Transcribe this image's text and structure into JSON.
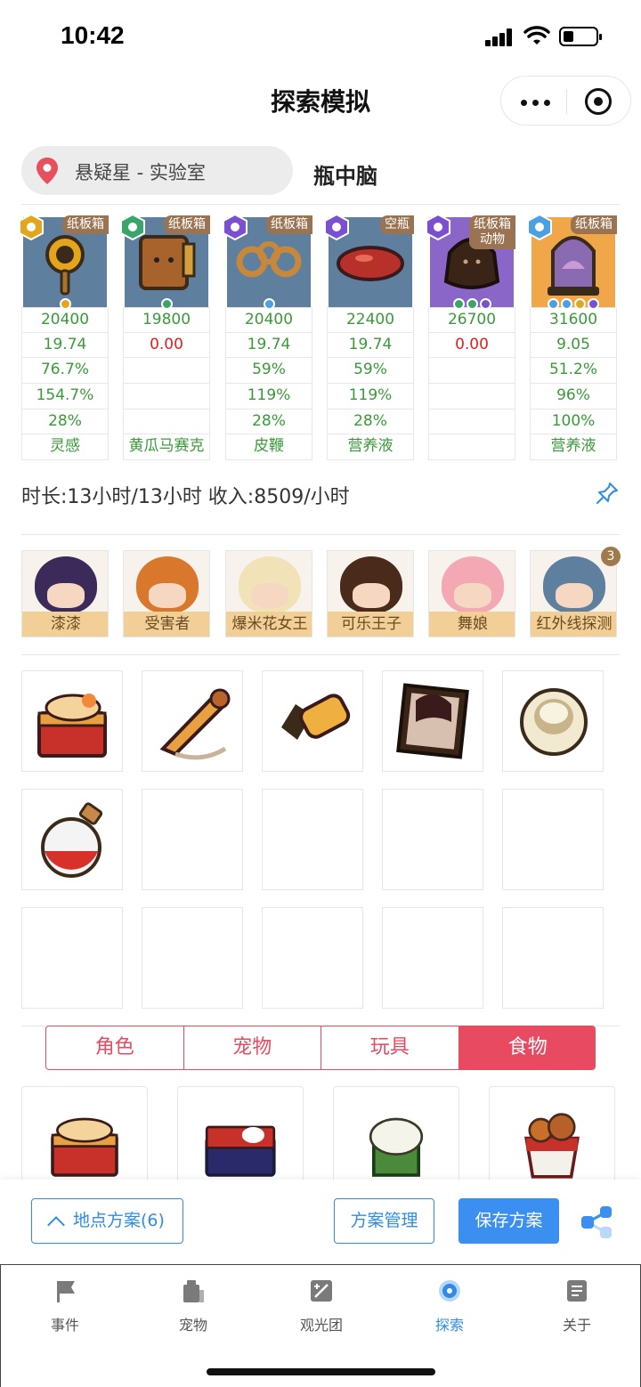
{
  "status": {
    "time": "10:42",
    "battery_level": 0.3
  },
  "nav": {
    "title": "探索模拟"
  },
  "location": {
    "name": "悬疑星 - 实验室",
    "scene": "瓶中脑"
  },
  "results": [
    {
      "tag": "纸板箱",
      "badge_color": "#e2a51c",
      "art": "magnifier",
      "bg": "#5f7f9f",
      "gems": [
        "#e2a51c"
      ],
      "stats": [
        "20400",
        "19.74",
        "76.7%",
        "154.7%",
        "28%",
        "灵感"
      ],
      "red_rows": []
    },
    {
      "tag": "纸板箱",
      "badge_color": "#3aa46a",
      "art": "box",
      "bg": "#5f7f9f",
      "gems": [
        "#3aa46a"
      ],
      "stats": [
        "19800",
        "0.00",
        "",
        "",
        "",
        "黄瓜马赛克"
      ],
      "red_rows": [
        1
      ]
    },
    {
      "tag": "纸板箱",
      "badge_color": "#7a4fd0",
      "art": "chain",
      "bg": "#5f7f9f",
      "gems": [
        "#4aa0e0"
      ],
      "stats": [
        "20400",
        "19.74",
        "59%",
        "119%",
        "28%",
        "皮鞭"
      ],
      "red_rows": []
    },
    {
      "tag": "空瓶",
      "badge_color": "#7a4fd0",
      "art": "blob",
      "bg": "#5f7f9f",
      "gems": [],
      "stats": [
        "22400",
        "19.74",
        "59%",
        "119%",
        "28%",
        "营养液"
      ],
      "red_rows": []
    },
    {
      "tag": "纸板箱",
      "tag2": "动物",
      "badge_color": "#7a4fd0",
      "art": "hat",
      "bg": "#8a66c8",
      "gems": [
        "#3aa46a",
        "#3aa46a",
        "#7a4fd0"
      ],
      "stats": [
        "26700",
        "0.00",
        "",
        "",
        "",
        ""
      ],
      "red_rows": [
        1
      ]
    },
    {
      "tag": "纸板箱",
      "badge_color": "#4aa0e0",
      "art": "jar",
      "bg": "#f0a74a",
      "gems": [
        "#4aa0e0",
        "#4aa0e0",
        "#e2a51c",
        "#7a4fd0"
      ],
      "stats": [
        "31600",
        "9.05",
        "51.2%",
        "96%",
        "100%",
        "营养液"
      ],
      "red_rows": []
    }
  ],
  "summary": "时长:13小时/13小时 收入:8509/小时",
  "characters": [
    {
      "name": "漆漆",
      "hair": "#3b2a5a"
    },
    {
      "name": "受害者",
      "hair": "#d9782c"
    },
    {
      "name": "爆米花女王",
      "hair": "#f2e2b8"
    },
    {
      "name": "可乐王子",
      "hair": "#4a2a1a"
    },
    {
      "name": "舞娘",
      "hair": "#f4a8b4"
    },
    {
      "name": "红外线探测",
      "hair": "#5f7f9f"
    }
  ],
  "character_count": "3",
  "items": [
    {
      "icon": "bento-box-icon"
    },
    {
      "icon": "horn-icon"
    },
    {
      "icon": "flashlight-icon"
    },
    {
      "icon": "portrait-icon"
    },
    {
      "icon": "tube-icon"
    },
    {
      "icon": "potion-icon"
    },
    {
      "icon": ""
    },
    {
      "icon": ""
    },
    {
      "icon": ""
    },
    {
      "icon": ""
    },
    {
      "icon": ""
    },
    {
      "icon": ""
    },
    {
      "icon": ""
    },
    {
      "icon": ""
    },
    {
      "icon": ""
    }
  ],
  "tabs": [
    {
      "label": "角色",
      "active": false
    },
    {
      "label": "宠物",
      "active": false
    },
    {
      "label": "玩具",
      "active": false
    },
    {
      "label": "食物",
      "active": true
    }
  ],
  "foods": [
    {
      "icon": "bento-box-icon"
    },
    {
      "icon": "sushi-box-icon"
    },
    {
      "icon": "rice-cup-icon"
    },
    {
      "icon": "chicken-bucket-icon"
    }
  ],
  "actions": {
    "plan_label": "地点方案(6)",
    "manage_label": "方案管理",
    "save_label": "保存方案"
  },
  "tabbar": [
    {
      "label": "事件",
      "icon": "flag-icon",
      "active": false
    },
    {
      "label": "宠物",
      "icon": "pet-icon",
      "active": false
    },
    {
      "label": "观光团",
      "icon": "tour-icon",
      "active": false
    },
    {
      "label": "探索",
      "icon": "explore-icon",
      "active": true
    },
    {
      "label": "关于",
      "icon": "about-icon",
      "active": false
    }
  ],
  "colors": {
    "accent_blue": "#2f8ce6",
    "accent_red": "#e84a62",
    "stat_green": "#3a9a38",
    "stat_red": "#e02020",
    "tag_brown": "#9a7452"
  }
}
